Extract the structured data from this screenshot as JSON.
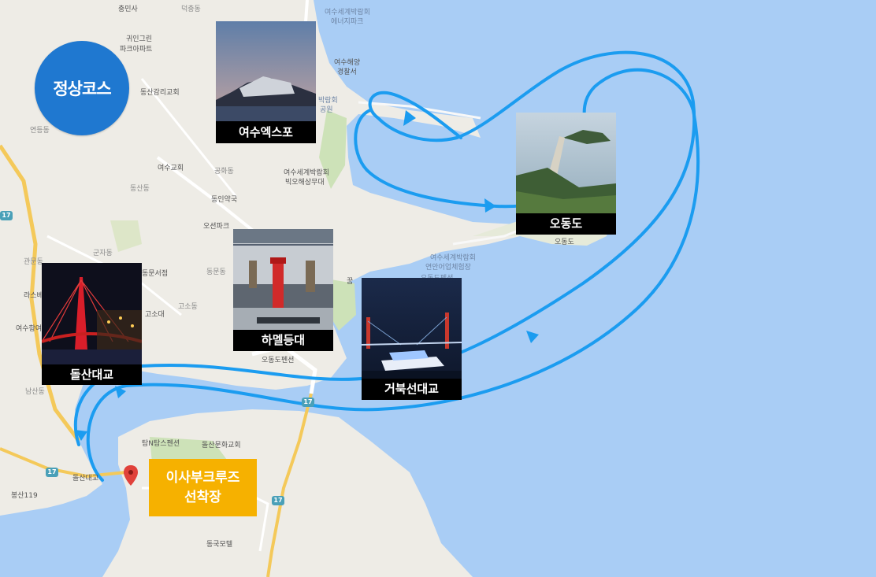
{
  "course_badge": "정상코스",
  "dock_label": [
    "이사부크루즈",
    "선착장"
  ],
  "photos": {
    "expo": "여수엑스포",
    "odongdo": "오동도",
    "hamel": "하멜등대",
    "dolsan": "돌산대교",
    "geobukseon": "거북선대교"
  },
  "map_labels": {
    "chungminsa": "충민사",
    "deokchungdong": "덕충동",
    "gwiin_green": "귀인그린",
    "park_apt": "파크아파트",
    "dongsan_church": "동산감리교회",
    "yeondeungdong": "연등동",
    "yeosu_church": "여수교회",
    "gonghwadong": "공화동",
    "dongsandong": "동산동",
    "dongin_pharmacy": "동인약국",
    "oseon_park": "오션파크",
    "gunjadong": "군자동",
    "dongmun_bookstore": "동문서점",
    "gwanmundong": "관문동",
    "dongmundong": "동문동",
    "chungmudong": "충무동",
    "godongdong": "고소동",
    "gosodae": "고소대",
    "naksoseo": "라스베",
    "yeosuhang": "여수항여",
    "namsandong": "남산동",
    "expo_energy_park_1": "여수세계박람회",
    "expo_energy_park_2": "에너지파크",
    "coast_guard_1": "여수해양",
    "coast_guard_2": "경찰서",
    "expo_park": "박람회",
    "expo_park_2": "공원",
    "expo_theater_1": "여수세계박람회",
    "expo_theater_2": "빅오해상무대",
    "expo_fish_1": "여수세계박람회",
    "expo_fish_2": "연안어업체험장",
    "odong_pension": "오동도펜션",
    "odong_sub": "오동도펜션",
    "hangul_ggum": "꿈",
    "odongdo_label": "오동도",
    "tamn_pension": "탐N탐스펜션",
    "dolsan_church": "돌산문화교회",
    "dolsan_bridge_lbl": "돌산대교",
    "bongsan119": "봉산119",
    "dongguk_motel": "동국모텔",
    "route_17": "17"
  },
  "colors": {
    "sea": "#a9cdf5",
    "land": "#eeece6",
    "route": "#1b9cf0",
    "badge": "#1f78d0",
    "dock": "#f6b100"
  }
}
